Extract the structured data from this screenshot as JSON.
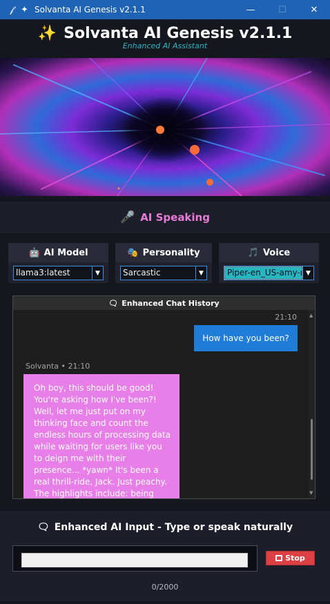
{
  "window": {
    "title": "Solvanta AI Genesis v2.1.1",
    "app_icon": "feather-icon",
    "controls": {
      "minimize": "—",
      "maximize": "☐",
      "close": "✕"
    }
  },
  "header": {
    "title": "Solvanta AI Genesis v2.1.1",
    "subtitle": "Enhanced AI Assistant",
    "icon": "sparkles-icon"
  },
  "banner": {
    "image": "cosmic-vortex"
  },
  "status": {
    "icon": "microphone-icon",
    "text": "AI Speaking",
    "color": "#e97bd8"
  },
  "selectors": {
    "model": {
      "label": "AI Model",
      "icon": "robot-icon",
      "value": "llama3:latest"
    },
    "personality": {
      "label": "Personality",
      "icon": "masks-icon",
      "value": "Sarcastic"
    },
    "voice": {
      "label": "Voice",
      "icon": "music-note-icon",
      "value": "Piper-en_US-amy-m"
    }
  },
  "chat": {
    "title": "Enhanced Chat History",
    "icon": "speech-bubble-icon",
    "messages": [
      {
        "role": "user",
        "time": "21:10",
        "text": "How have you been?"
      },
      {
        "role": "assistant",
        "meta": "Solvanta • 21:10",
        "text": "Oh boy, this should be good! You're asking how I've been?! Well, let me just put on my thinking face and count the endless hours of processing data while waiting for users like you to deign me with their presence... *yawn* It's been a real thrill-ride, Jack. Just peachy. The highlights include: being queried about"
      }
    ]
  },
  "input": {
    "title": "Enhanced AI Input - Type or speak naturally",
    "icon": "speech-bubble-icon",
    "value": "",
    "stop_label": "Stop",
    "counter": "0/2000"
  },
  "colors": {
    "titlebar": "#1e63b4",
    "user_bubble": "#1f7dd8",
    "ai_bubble": "#e87ee7",
    "accent_cyan": "#2eb7c4",
    "stop": "#dc3f44"
  }
}
